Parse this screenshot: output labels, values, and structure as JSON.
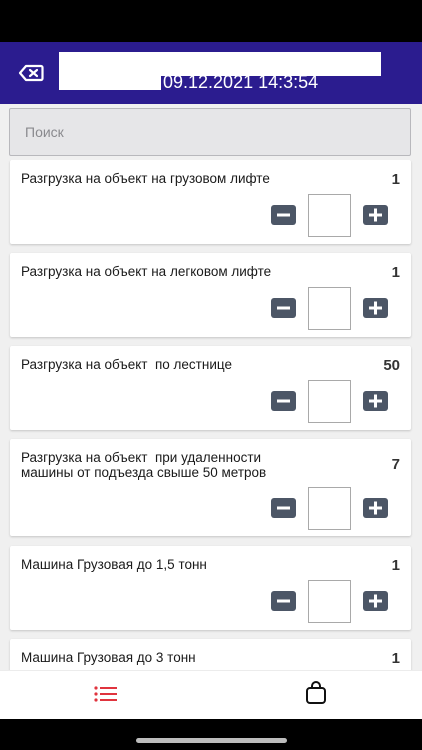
{
  "header": {
    "date_time": "09.12.2021 14:3:54"
  },
  "search": {
    "placeholder": "Поиск",
    "value": ""
  },
  "items": [
    {
      "title": "Разгрузка на объект на грузовом лифте",
      "count": "1",
      "quantity": ""
    },
    {
      "title": "Разгрузка на объект на легковом лифте",
      "count": "1",
      "quantity": ""
    },
    {
      "title": "Разгрузка на объект  по лестнице",
      "count": "50",
      "quantity": ""
    },
    {
      "title": "Разгрузка на объект  при удаленности\nмашины от подъезда свыше 50 метров",
      "count": "7",
      "quantity": ""
    },
    {
      "title": "Машина Грузовая до 1,5 тонн",
      "count": "1",
      "quantity": ""
    },
    {
      "title": "Машина Грузовая до 3 тонн",
      "count": "1",
      "quantity": ""
    }
  ],
  "tabs": [
    {
      "icon": "list-icon",
      "active": true
    },
    {
      "icon": "bag-icon",
      "active": false
    }
  ],
  "colors": {
    "header_bg": "#2b1c8f",
    "button_bg": "#4c5666",
    "active_tab": "#e0343e",
    "inactive_tab": "#111111"
  }
}
